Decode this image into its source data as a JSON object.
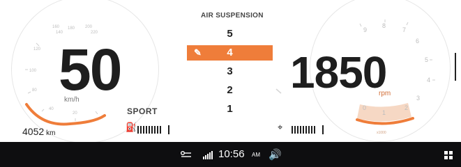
{
  "speedometer": {
    "speed": "50",
    "unit": "km/h"
  },
  "tachometer": {
    "rpm": "1850",
    "unit": "rpm"
  },
  "drive_mode": "SPORT",
  "odometer": {
    "value": "4052",
    "unit": "km"
  },
  "air_suspension": {
    "title": "AIR SUSPENSION",
    "levels": [
      "5",
      "4",
      "3",
      "2",
      "1"
    ],
    "selected": "4",
    "accent_color": "#ef7d3a"
  },
  "status_bar": {
    "time": "10:56",
    "ampm": "AM"
  },
  "icons": [
    "fuel-pump-icon",
    "coolant-temperature-icon",
    "key-icon",
    "signal-strength-icon",
    "volume-icon",
    "app-grid-icon",
    "suspension-pin-icon"
  ]
}
